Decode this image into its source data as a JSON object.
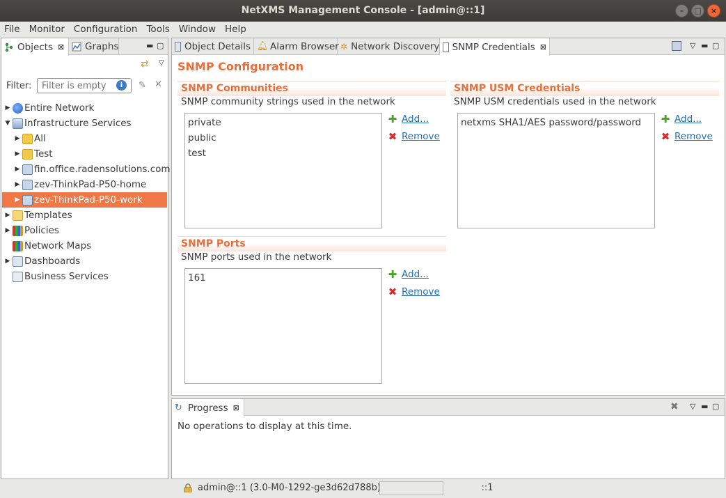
{
  "window": {
    "title": "NetXMS Management Console - [admin@::1]",
    "controls": [
      "minimize-icon",
      "maximize-icon",
      "close-icon"
    ]
  },
  "menu": [
    "File",
    "Monitor",
    "Configuration",
    "Tools",
    "Window",
    "Help"
  ],
  "left_panel": {
    "tabs": [
      {
        "label": "Objects",
        "active": true,
        "closable": true
      },
      {
        "label": "Graphs",
        "active": false,
        "closable": false
      }
    ],
    "filter": {
      "label": "Filter:",
      "placeholder": "Filter is empty",
      "value": ""
    },
    "tree": [
      {
        "label": "Entire Network",
        "expanded": false,
        "icon": "network-icon"
      },
      {
        "label": "Infrastructure Services",
        "expanded": true,
        "icon": "infrastructure-icon"
      },
      {
        "label": "All",
        "expanded": false,
        "icon": "container-icon"
      },
      {
        "label": "Test",
        "expanded": false,
        "icon": "container-icon"
      },
      {
        "label": "fin.office.radensolutions.com",
        "expanded": false,
        "icon": "node-icon"
      },
      {
        "label": "zev-ThinkPad-P50-home",
        "expanded": false,
        "icon": "node-icon"
      },
      {
        "label": "zev-ThinkPad-P50-work",
        "expanded": false,
        "icon": "node-icon",
        "selected": true
      },
      {
        "label": "Templates",
        "expanded": false,
        "icon": "templates-icon"
      },
      {
        "label": "Policies",
        "expanded": false,
        "icon": "policies-icon"
      },
      {
        "label": "Network Maps",
        "expanded": null,
        "icon": "maps-icon"
      },
      {
        "label": "Dashboards",
        "expanded": false,
        "icon": "dashboards-icon"
      },
      {
        "label": "Business Services",
        "expanded": null,
        "icon": "business-icon"
      }
    ]
  },
  "editor": {
    "tabs": [
      {
        "label": "Object Details",
        "active": false
      },
      {
        "label": "Alarm Browser",
        "active": false
      },
      {
        "label": "Network Discovery",
        "active": false
      },
      {
        "label": "SNMP Credentials",
        "active": true
      }
    ],
    "heading": "SNMP Configuration",
    "communities": {
      "title": "SNMP Communities",
      "description": "SNMP community strings used in the network",
      "items": [
        "private",
        "public",
        "test"
      ],
      "add": "Add...",
      "remove": "Remove"
    },
    "usm": {
      "title": "SNMP USM Credentials",
      "description": "SNMP USM credentials used in the network",
      "items": [
        "netxms SHA1/AES password/password"
      ],
      "add": "Add...",
      "remove": "Remove"
    },
    "ports": {
      "title": "SNMP Ports",
      "description": "SNMP ports used in the network",
      "items": [
        "161"
      ],
      "add": "Add...",
      "remove": "Remove"
    }
  },
  "progress": {
    "tab": "Progress",
    "message": "No operations to display at this time."
  },
  "status": {
    "user": "admin@::1 (3.0-M0-1292-ge3d62d788b)",
    "server": "::1"
  },
  "colors": {
    "accent": "#e96e3a",
    "selection": "#f07746",
    "link": "#1e6fb4"
  }
}
